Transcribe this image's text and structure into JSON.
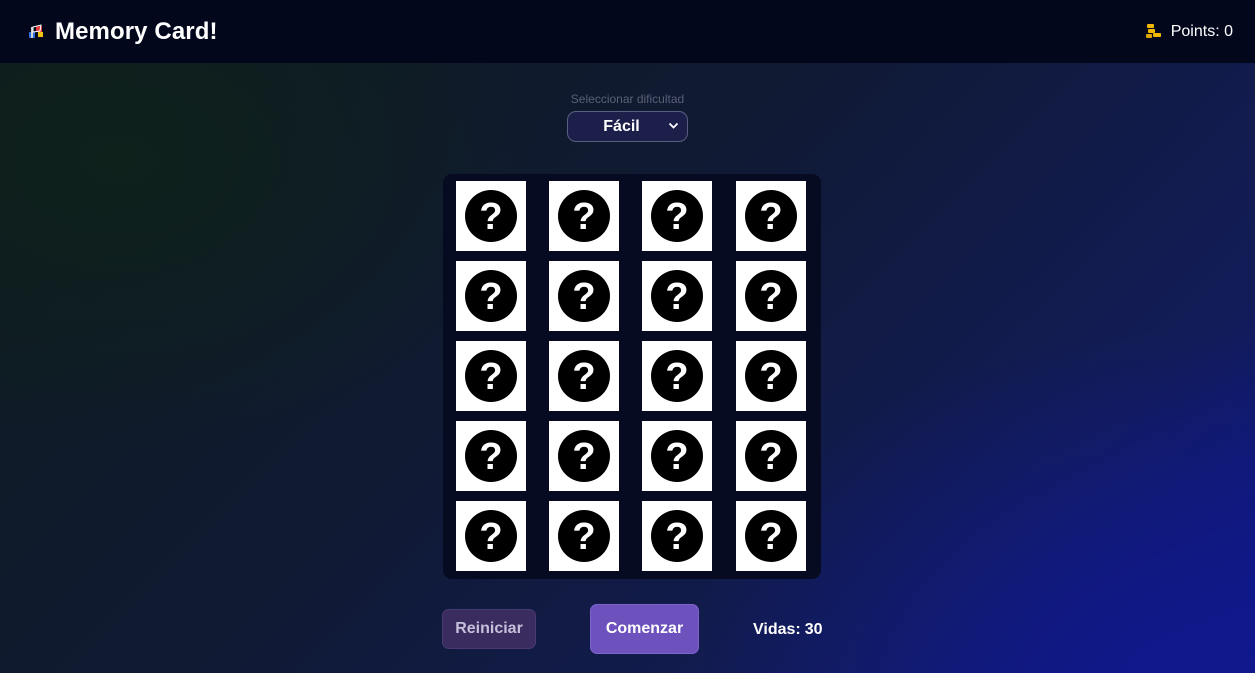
{
  "header": {
    "title": "Memory Card!",
    "brand_icon": "race-flag-icon",
    "points_label": "Points:",
    "points_value": "0",
    "points_icon": "coin-stack-icon"
  },
  "difficulty": {
    "label": "Seleccionar dificultad",
    "selected": "Fácil"
  },
  "board": {
    "rows": 5,
    "columns": 4,
    "card_icon": "question-circle-icon",
    "cards": [
      "?",
      "?",
      "?",
      "?",
      "?",
      "?",
      "?",
      "?",
      "?",
      "?",
      "?",
      "?",
      "?",
      "?",
      "?",
      "?",
      "?",
      "?",
      "?",
      "?"
    ]
  },
  "controls": {
    "restart_label": "Reiniciar",
    "start_label": "Comenzar",
    "lives_label": "Vidas:",
    "lives_value": "30"
  },
  "colors": {
    "header_bg": "#03071c",
    "accent": "#6d52bd",
    "restart_bg": "#3a2c5f",
    "card_bg": "#ffffff",
    "board_bg": "#070b22"
  }
}
